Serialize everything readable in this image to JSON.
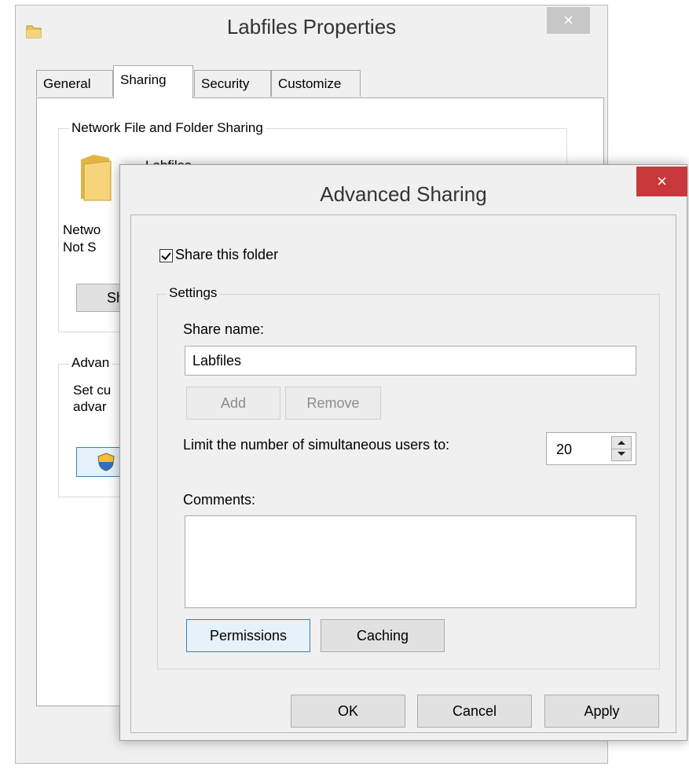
{
  "properties_window": {
    "title": "Labfiles Properties",
    "close_glyph": "×",
    "tabs": [
      "General",
      "Sharing",
      "Security",
      "Customize"
    ],
    "active_tab": "Sharing",
    "network_group": {
      "label": "Network File and Folder Sharing",
      "folder_name": "Labfiles",
      "network_path_partial": "Netwo",
      "status_partial": "Not S",
      "share_button_partial": "Sh"
    },
    "advanced_group": {
      "label_partial": "Advan",
      "desc_line1_partial": "Set cu",
      "desc_line2_partial": "advar"
    }
  },
  "advanced_sharing": {
    "title": "Advanced Sharing",
    "close_glyph": "×",
    "share_checkbox": {
      "label": "Share this folder",
      "checked": true
    },
    "settings_label": "Settings",
    "share_name_label": "Share name:",
    "share_name_value": "Labfiles",
    "add_button": "Add",
    "remove_button": "Remove",
    "limit_label": "Limit the number of simultaneous users to:",
    "limit_value": "20",
    "comments_label": "Comments:",
    "comments_value": "",
    "permissions_button": "Permissions",
    "caching_button": "Caching",
    "ok_button": "OK",
    "cancel_button": "Cancel",
    "apply_button": "Apply"
  },
  "colors": {
    "close_active": "#c7393b",
    "close_inactive": "#c7c7c7",
    "window_bg": "#f0f0f0",
    "focus_border": "#3c7fb1"
  },
  "icons": [
    "folder-icon",
    "shield-icon",
    "close-icon",
    "spin-up-icon",
    "spin-down-icon",
    "checkmark-icon"
  ]
}
